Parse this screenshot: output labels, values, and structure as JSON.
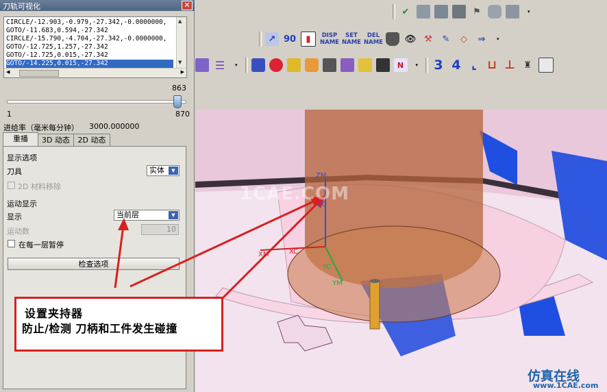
{
  "dialog": {
    "title": "刀轨可视化",
    "close_label": "✕",
    "list_rows": [
      "CIRCLE/-12.903,-0.979,-27.342,-0.0000000,",
      "GOTO/-11.683,0.594,-27.342",
      "CIRCLE/-15.790,-4.704,-27.342,-0.0000000,",
      "GOTO/-12.725,1.257,-27.342",
      "GOTO/-12.725,0.015,-27.342",
      "GOTO/-14.225,0.015,-27.342"
    ],
    "selected_row": 5,
    "slider": {
      "current": "863",
      "min": "1",
      "max": "870",
      "value": 863,
      "range": [
        1,
        870
      ]
    },
    "feed_label": "进给率（毫米每分钟）",
    "feed_value": "3000.000000",
    "tabs": [
      "重播",
      "3D 动态",
      "2D 动态"
    ],
    "active_tab": 0,
    "display_options_heading": "显示选项",
    "tool_label": "刀具",
    "tool_value": "实体",
    "material_removal_2d": "2D 材料移除",
    "motion_display_heading": "运动显示",
    "display_label": "显示",
    "display_value": "当前层",
    "motion_count_label": "运动数",
    "motion_count_value": "10",
    "pause_each_layer": "在每一层暂停",
    "check_options_button": "检查选项"
  },
  "toolbar": {
    "disp_label": "DISP\nNAME",
    "set_label": "SET\nNAME",
    "del_label": "DEL\nNAME",
    "big_3": "3",
    "big_4": "4",
    "num_90": "90"
  },
  "viewport": {
    "axis_zm": "ZM",
    "axis_zc": "ZC",
    "axis_xm": "XM",
    "axis_xc": "XC",
    "axis_yc": "YC",
    "axis_ym": "YM",
    "watermark": "1CAE.COM"
  },
  "annotation": {
    "line1": "设置夹持器",
    "line2": "防止/检测 刀柄和工件发生碰撞"
  },
  "corner_watermark": {
    "line1": "仿真在线",
    "line2": "www.1CAE.com"
  },
  "colors": {
    "accent_red": "#d72020",
    "selection_blue": "#316ac5",
    "tool_copper": "#b4643a",
    "part_pink": "#f6d6e6",
    "fixture_blue": "#1f4fe0"
  }
}
